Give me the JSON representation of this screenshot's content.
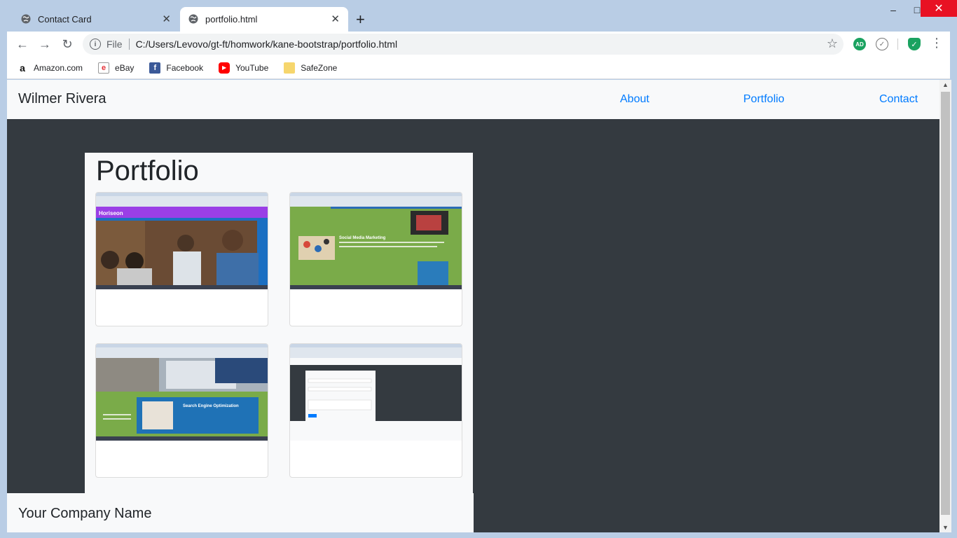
{
  "tabs": [
    {
      "title": "Contact Card",
      "close": "✕"
    },
    {
      "title": "portfolio.html",
      "close": "✕"
    }
  ],
  "new_tab": "+",
  "window": {
    "minimize": "–",
    "maximize": "□",
    "close": "✕"
  },
  "toolbar": {
    "back": "←",
    "forward": "→",
    "reload": "↻",
    "info": "i",
    "file_label": "File",
    "url": "C:/Users/Levovo/gt-ft/homwork/kane-bootstrap/portfolio.html",
    "star": "☆",
    "menu": "⋮",
    "ext_adblock": "AD"
  },
  "bookmarks": [
    {
      "label": "Amazon.com",
      "icon": "amazon-icon",
      "glyph": "a",
      "color": "#ffffff"
    },
    {
      "label": "eBay",
      "icon": "ebay-icon",
      "glyph": "e",
      "color": "#e53238"
    },
    {
      "label": "Facebook",
      "icon": "facebook-icon",
      "glyph": "f",
      "color": "#3b5998"
    },
    {
      "label": "YouTube",
      "icon": "youtube-icon",
      "glyph": "▶",
      "color": "#ff0000"
    },
    {
      "label": "SafeZone",
      "icon": "folder-icon",
      "glyph": "",
      "color": "#f6d66d"
    }
  ],
  "page": {
    "brand": "Wilmer Rivera",
    "nav": [
      "About",
      "Portfolio",
      "Contact"
    ],
    "heading": "Portfolio",
    "footer": "Your Company Name",
    "link_color": "#007bff",
    "dark_bg": "#343a40"
  },
  "cards": [
    {
      "name": "card-horiseon-screenshot",
      "caption": "Horiseon"
    },
    {
      "name": "card-social-media-screenshot",
      "caption": "Social Media Marketing"
    },
    {
      "name": "card-seo-screenshot",
      "caption": "Search Engine Optimization"
    },
    {
      "name": "card-contact-form-screenshot",
      "caption": ""
    }
  ]
}
